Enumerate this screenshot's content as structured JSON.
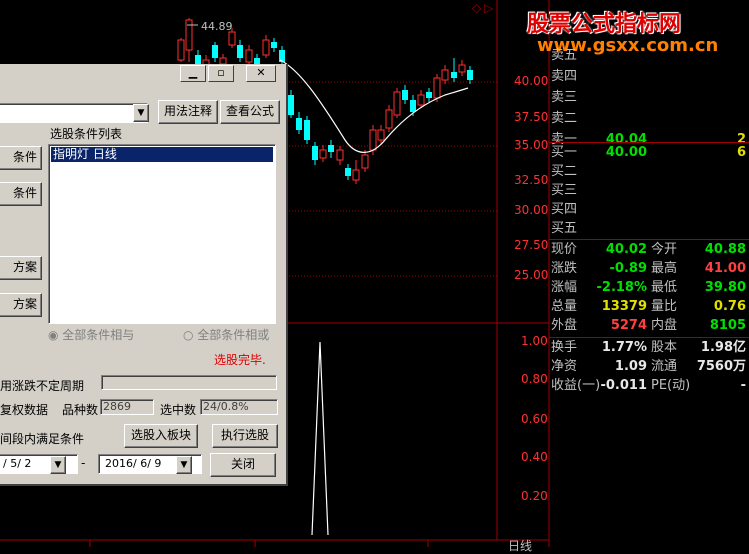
{
  "chart": {
    "price_labels": [
      "40.00",
      "37.50",
      "35.00",
      "32.50",
      "30.00",
      "27.50",
      "25.00"
    ],
    "high_marker": "44.89",
    "indicator_labels": [
      "1.00",
      "0.80",
      "0.60",
      "0.40",
      "0.20"
    ],
    "period_label": "日线",
    "colors": {
      "up": "#ff3030",
      "down": "#00ffff",
      "ma": "#ffffff",
      "grid": "#a00000"
    }
  },
  "watermark": {
    "cn": "股票公式指标网",
    "url": "www.gsxx.com.cn"
  },
  "quote": {
    "sells": [
      {
        "label": "卖五",
        "price": "",
        "vol": ""
      },
      {
        "label": "卖四",
        "price": "",
        "vol": ""
      },
      {
        "label": "卖三",
        "price": "",
        "vol": ""
      },
      {
        "label": "卖二",
        "price": "",
        "vol": ""
      },
      {
        "label": "卖一",
        "price": "40.04",
        "vol": "2"
      }
    ],
    "buys": [
      {
        "label": "买一",
        "price": "40.00",
        "vol": "6"
      },
      {
        "label": "买二",
        "price": "",
        "vol": ""
      },
      {
        "label": "买三",
        "price": "",
        "vol": ""
      },
      {
        "label": "买四",
        "price": "",
        "vol": ""
      },
      {
        "label": "买五",
        "price": "",
        "vol": ""
      }
    ],
    "stats": [
      {
        "l1": "现价",
        "v1": "40.02",
        "c1": "green",
        "l2": "今开",
        "v2": "40.88",
        "c2": "green"
      },
      {
        "l1": "涨跌",
        "v1": "-0.89",
        "c1": "green",
        "l2": "最高",
        "v2": "41.00",
        "c2": "red"
      },
      {
        "l1": "涨幅",
        "v1": "-2.18%",
        "c1": "green",
        "l2": "最低",
        "v2": "39.80",
        "c2": "green"
      },
      {
        "l1": "总量",
        "v1": "13379",
        "c1": "yellow",
        "l2": "量比",
        "v2": "0.76",
        "c2": "yellow"
      },
      {
        "l1": "外盘",
        "v1": "5274",
        "c1": "red",
        "l2": "内盘",
        "v2": "8105",
        "c2": "green"
      }
    ],
    "stats2": [
      {
        "l1": "换手",
        "v1": "1.77%",
        "l2": "股本",
        "v2": "1.98亿"
      },
      {
        "l1": "净资",
        "v1": "1.09",
        "l2": "流通",
        "v2": "7560万"
      },
      {
        "l1": "收益(一)",
        "v1": "-0.011",
        "l2": "PE(动)",
        "v2": "-"
      }
    ]
  },
  "dialog": {
    "btn_usage": "用法注释",
    "btn_view": "查看公式",
    "left_btn1": "条件",
    "left_btn2": "条件",
    "left_btn3": "方案",
    "left_btn4": "方案",
    "list_title": "选股条件列表",
    "list_items": [
      "指明灯  日线"
    ],
    "radio_and": "全部条件相与",
    "radio_or": "全部条件相或",
    "status": "选股完毕.",
    "opt_period": "用涨跌不定周期",
    "opt_rights": "复权数据",
    "count_label": "品种数",
    "count_value": "2869",
    "selected_label": "选中数",
    "selected_value": "24/0.8%",
    "opt_interval": "间段内满足条件",
    "btn_to_block": "选股入板块",
    "btn_execute": "执行选股",
    "date_from": "/ 5/ 2",
    "date_sep": "-",
    "date_to": "2016/ 6/ 9",
    "btn_close": "关闭"
  }
}
